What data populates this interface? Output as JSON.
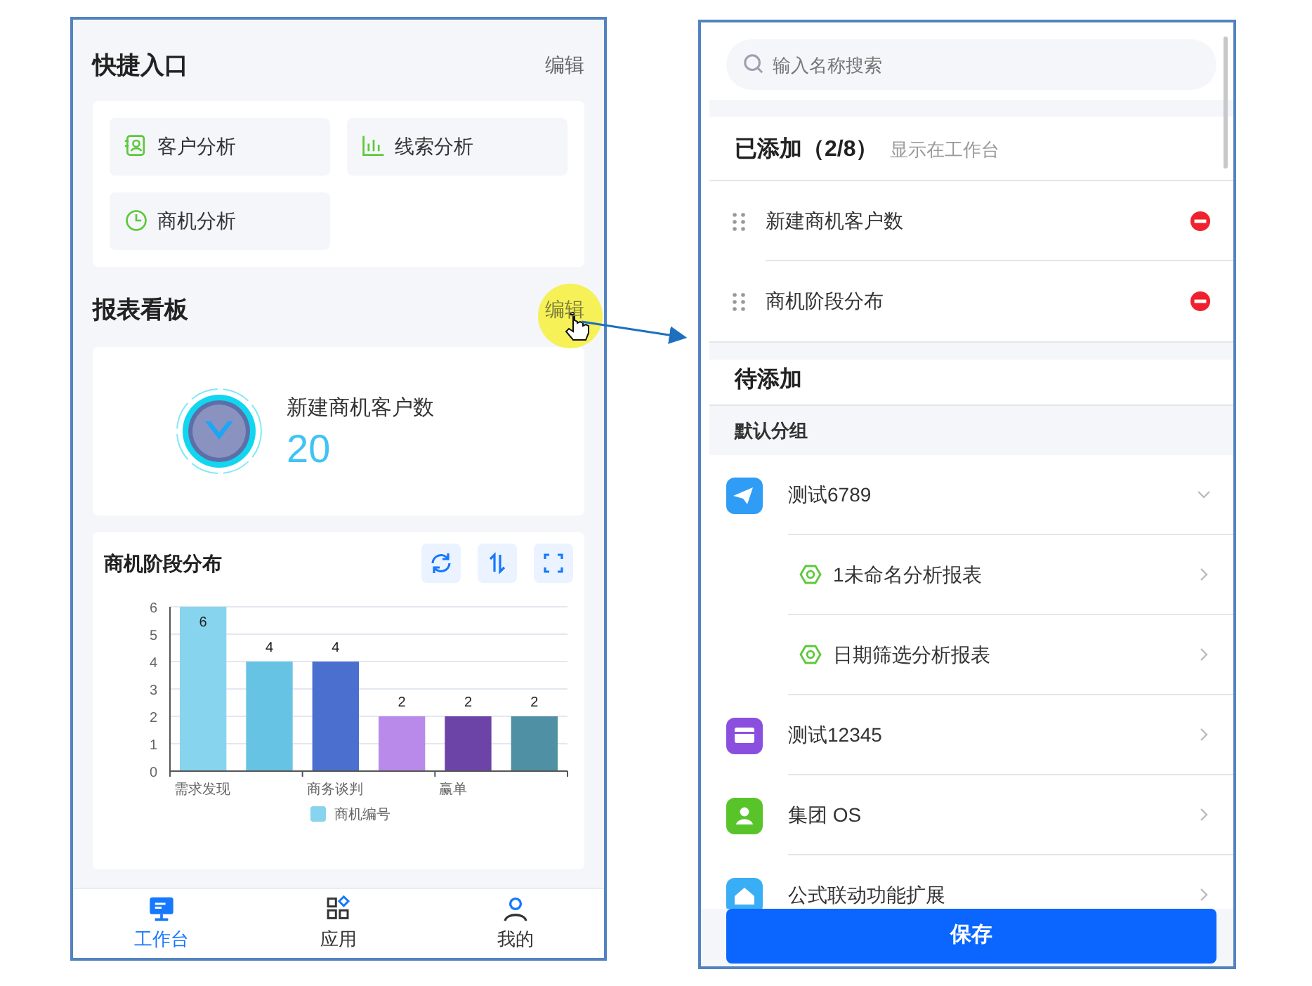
{
  "left_screen": {
    "quick_entry": {
      "title": "快捷入口",
      "edit": "编辑",
      "items": [
        {
          "label": "客户分析"
        },
        {
          "label": "线索分析"
        },
        {
          "label": "商机分析"
        }
      ]
    },
    "board": {
      "title": "报表看板",
      "edit": "编辑"
    },
    "metric": {
      "label": "新建商机客户数",
      "value": "20"
    },
    "chart_card": {
      "title": "商机阶段分布",
      "chart_data": {
        "type": "bar",
        "categories": [
          "需求发现",
          null,
          "商务谈判",
          null,
          "赢单",
          null
        ],
        "yticks": [
          0,
          1,
          2,
          3,
          4,
          5,
          6
        ],
        "ylim": [
          0,
          6
        ],
        "data_labels": true,
        "grid": true,
        "series": [
          {
            "name": "商机编号",
            "color": "#87d4ee",
            "values": [
              6,
              null,
              null,
              null,
              null,
              null
            ]
          },
          {
            "color": "#67c3e4",
            "values": [
              null,
              4,
              null,
              null,
              null,
              null
            ]
          },
          {
            "color": "#4a6fcf",
            "values": [
              null,
              null,
              4,
              null,
              null,
              null
            ]
          },
          {
            "color": "#b98ae9",
            "values": [
              null,
              null,
              null,
              2,
              null,
              null
            ]
          },
          {
            "color": "#6c43a6",
            "values": [
              null,
              null,
              null,
              null,
              2,
              null
            ]
          },
          {
            "color": "#5090a4",
            "values": [
              null,
              null,
              null,
              null,
              null,
              2
            ]
          }
        ]
      }
    },
    "tab_bar": [
      {
        "label": "工作台",
        "selected": true
      },
      {
        "label": "应用",
        "selected": false
      },
      {
        "label": "我的",
        "selected": false
      }
    ]
  },
  "right_screen": {
    "search": {
      "placeholder": "输入名称搜索"
    },
    "added": {
      "title": "已添加（2/8）",
      "hint": "显示在工作台",
      "items": [
        {
          "label": "新建商机客户数"
        },
        {
          "label": "商机阶段分布"
        }
      ]
    },
    "pending": {
      "title": "待添加",
      "group": "默认分组",
      "apps": [
        {
          "label": "测试6789",
          "color": "#2f9cf5",
          "expanded": true,
          "children": [
            {
              "label": "1未命名分析报表"
            },
            {
              "label": "日期筛选分析报表"
            }
          ]
        },
        {
          "label": "测试12345",
          "color": "#8b4fe0",
          "expanded": false
        },
        {
          "label": "集团 OS",
          "color": "#58c42a",
          "expanded": false
        },
        {
          "label": "公式联动功能扩展",
          "color": "#3aaef5",
          "expanded": false
        }
      ]
    },
    "save": "保存"
  }
}
